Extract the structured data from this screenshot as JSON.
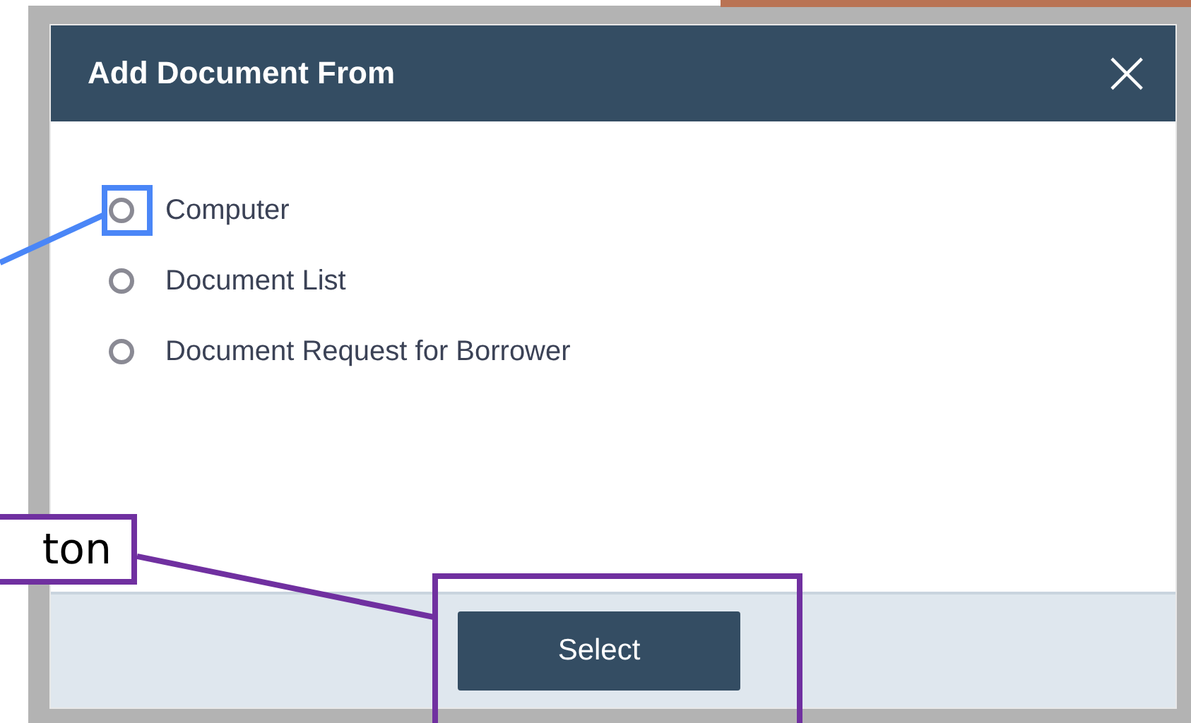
{
  "dialog": {
    "title": "Add Document From",
    "close": "×",
    "options": [
      {
        "label": "Computer",
        "selected": false
      },
      {
        "label": "Document List",
        "selected": false
      },
      {
        "label": "Document Request for Borrower",
        "selected": false
      }
    ],
    "button": "Select"
  },
  "annotations": [
    {
      "kind": "focus-box"
    },
    {
      "kind": "callout",
      "text": "ton"
    },
    {
      "kind": "button-box"
    }
  ]
}
